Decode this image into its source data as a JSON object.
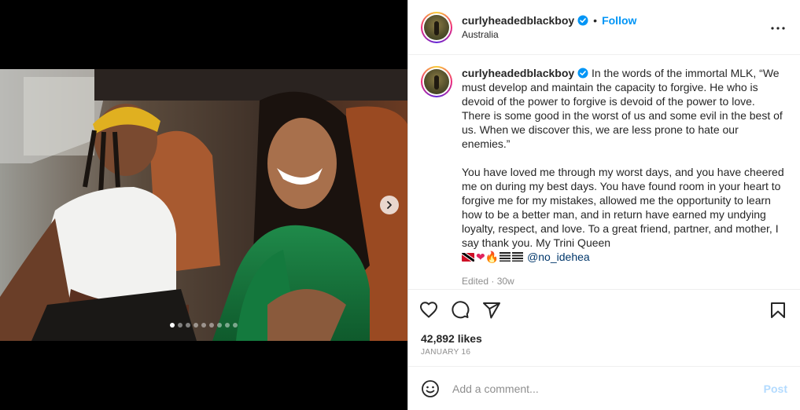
{
  "post": {
    "username": "curlyheadedblackboy",
    "follow_label": "Follow",
    "separator": "•",
    "location": "Australia",
    "caption": {
      "intro": "In the words of the immortal MLK,",
      "quote": "“We must develop and maintain the capacity to forgive. He who is devoid of the power to forgive is devoid of the power to love. There is some good in the worst of us and some evil in the best of us. When we discover this, we are less prone to hate our enemies.”",
      "body": "You have loved me through my worst days, and you have cheered me on during my best days. You have found room in your heart to forgive me for my mistakes, allowed me the opportunity to learn how to be a better man, and in return have earned my undying loyalty, respect, and love. To a great friend, partner, and mother, I say thank you. My Trini Queen",
      "emoji_heart": "❤",
      "emoji_fire": "🔥",
      "mention": "@no_idehea"
    },
    "edited": "Edited · 30w",
    "likes": "42,892 likes",
    "date": "JANUARY 16",
    "carousel": {
      "total": 9,
      "active_index": 0
    }
  },
  "comment": {
    "placeholder": "Add a comment...",
    "post_label": "Post"
  },
  "icons": {
    "more": "more-options-icon",
    "like": "heart-icon",
    "comment": "comment-icon",
    "share": "share-icon",
    "save": "bookmark-icon",
    "emoji": "emoji-icon",
    "verified": "verified-badge-icon",
    "next": "chevron-right-icon"
  },
  "colors": {
    "accent": "#0095f6",
    "post_disabled": "#b3dbff",
    "muted": "#8e8e8e"
  }
}
